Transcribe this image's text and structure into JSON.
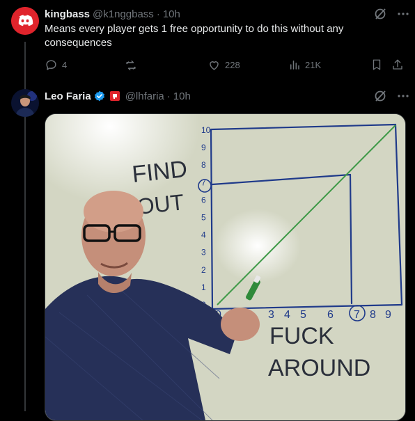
{
  "thread": {
    "first_tweet": {
      "display_name": "kingbass",
      "handle": "@k1nggbass",
      "separator": "·",
      "time": "10h",
      "text": "Means every player gets 1 free opportunity to do this without any consequences",
      "actions": {
        "replies": "4",
        "reposts": "",
        "likes": "228",
        "views": "21K"
      },
      "icons": [
        "grok-icon",
        "more-icon",
        "reply-icon",
        "repost-icon",
        "like-icon",
        "views-icon",
        "bookmark-icon",
        "share-icon"
      ]
    },
    "second_tweet": {
      "display_name": "Leo Faria",
      "handle": "@lhfaria",
      "separator": "·",
      "time": "10h",
      "media": {
        "whiteboard_texts": {
          "y_label_top": "FIND",
          "y_label_bottom": "OUT",
          "x_label_top": "FUCK",
          "x_label_bottom": "AROUND",
          "y_ticks": [
            "10",
            "9",
            "8",
            "7",
            "6",
            "5",
            "4",
            "3",
            "2",
            "1",
            "0"
          ],
          "x_ticks": [
            "0",
            "3",
            "4",
            "5",
            "6",
            "7",
            "8",
            "9"
          ]
        }
      }
    }
  },
  "colors": {
    "background": "#000000",
    "text": "#e7e9ea",
    "muted": "#71767b",
    "verified": "#1d9bf0",
    "discord_red": "#e0242c"
  }
}
